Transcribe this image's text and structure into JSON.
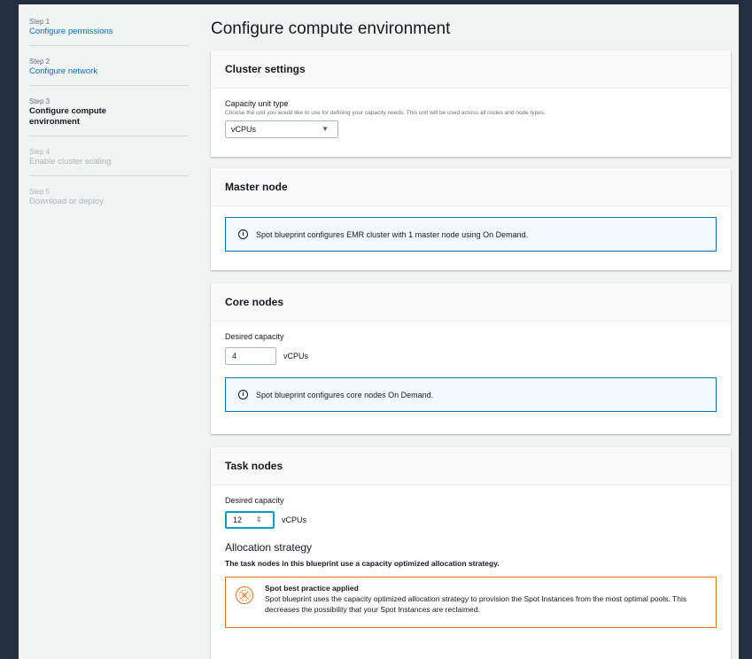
{
  "steps": [
    {
      "num": "Step 1",
      "title": "Configure permissions"
    },
    {
      "num": "Step 2",
      "title": "Configure network"
    },
    {
      "num": "Step 3",
      "title": "Configure compute environment"
    },
    {
      "num": "Step 4",
      "title": "Enable cluster scaling"
    },
    {
      "num": "Step 5",
      "title": "Download or deploy"
    }
  ],
  "page_title": "Configure compute environment",
  "cluster_settings": {
    "header": "Cluster settings",
    "label": "Capacity unit type",
    "description": "Choose the unit you would like to use for defining your capacity needs. This unit will be used across all nodes and node types.",
    "selected": "vCPUs"
  },
  "master_node": {
    "header": "Master node",
    "info": "Spot blueprint configures EMR cluster with 1 master node using On Demand."
  },
  "core_nodes": {
    "header": "Core nodes",
    "label": "Desired capacity",
    "value": "4",
    "unit": "vCPUs",
    "info": "Spot blueprint configures core nodes On Demand."
  },
  "task_nodes": {
    "header": "Task nodes",
    "label": "Desired capacity",
    "value": "12",
    "unit": "vCPUs",
    "allocation_heading": "Allocation strategy",
    "allocation_text": "The task nodes in this blueprint use a capacity optimized allocation strategy.",
    "best_practice_title": "Spot best practice applied",
    "best_practice_text": "Spot blueprint uses the capacity optimized allocation strategy to provision the Spot Instances from the most optimal pools. This decreases the possibility that your Spot Instances are reclaimed."
  },
  "colors": {
    "link": "#0073bb",
    "info_border": "#0073bb",
    "warning_border": "#ec7211",
    "focus": "#00a1c9"
  },
  "icons": {
    "info": "info-circle-icon",
    "select_caret": "caret-down-icon",
    "spinner": "spinner-arrows-icon",
    "best_practice": "spot-badge-icon"
  }
}
